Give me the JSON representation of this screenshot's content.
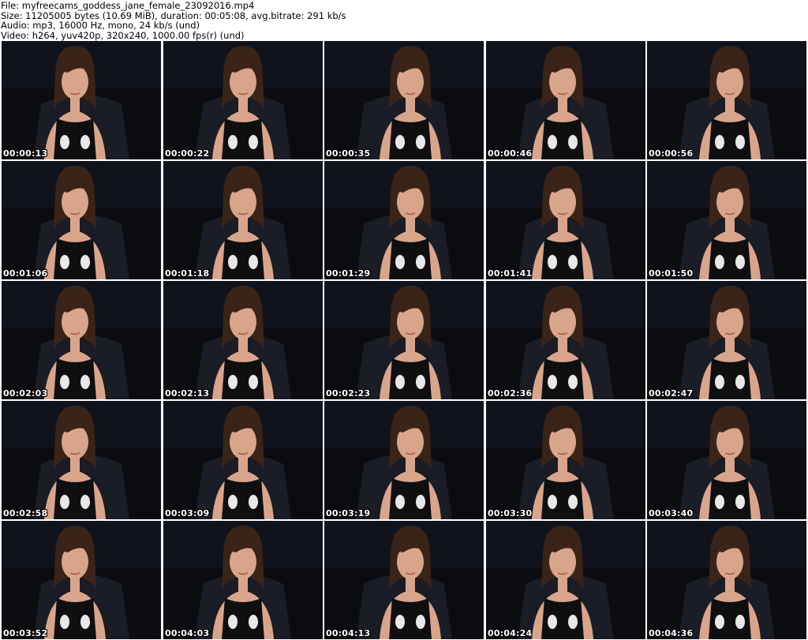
{
  "header": {
    "file_line": "File: myfreecams_goddess_jane_female_23092016.mp4",
    "size_line": "Size: 11205005 bytes (10.69 MiB), duration: 00:05:08, avg.bitrate: 291 kb/s",
    "audio_line": "Audio: mp3, 16000 Hz, mono, 24 kb/s (und)",
    "video_line": "Video: h264, yuv420p, 320x240, 1000.00 fps(r) (und)"
  },
  "thumbnails": [
    {
      "timestamp": "00:00:13"
    },
    {
      "timestamp": "00:00:22"
    },
    {
      "timestamp": "00:00:35"
    },
    {
      "timestamp": "00:00:46"
    },
    {
      "timestamp": "00:00:56"
    },
    {
      "timestamp": "00:01:06"
    },
    {
      "timestamp": "00:01:18"
    },
    {
      "timestamp": "00:01:29"
    },
    {
      "timestamp": "00:01:41"
    },
    {
      "timestamp": "00:01:50"
    },
    {
      "timestamp": "00:02:03"
    },
    {
      "timestamp": "00:02:13"
    },
    {
      "timestamp": "00:02:23"
    },
    {
      "timestamp": "00:02:36"
    },
    {
      "timestamp": "00:02:47"
    },
    {
      "timestamp": "00:02:58"
    },
    {
      "timestamp": "00:03:09"
    },
    {
      "timestamp": "00:03:19"
    },
    {
      "timestamp": "00:03:30"
    },
    {
      "timestamp": "00:03:40"
    },
    {
      "timestamp": "00:03:52"
    },
    {
      "timestamp": "00:04:03"
    },
    {
      "timestamp": "00:04:13"
    },
    {
      "timestamp": "00:04:24"
    },
    {
      "timestamp": "00:04:36"
    }
  ],
  "colors": {
    "background": "#0b0c10",
    "skin": "#d9a58a",
    "hair": "#3a2418",
    "top": "#0f0f12",
    "chair": "#1a1c26"
  }
}
